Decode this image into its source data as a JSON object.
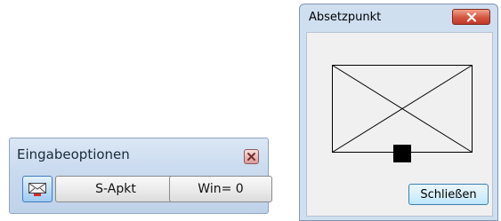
{
  "toolbar": {
    "title": "Eingabeoptionen",
    "buttons": {
      "sapkt": "S-Apkt",
      "win": "Win= 0"
    }
  },
  "dialog": {
    "title": "Absetzpunkt",
    "close_button": "Schließen"
  },
  "icons": {
    "toolbar_close": "close-icon",
    "toolbar_mode": "envelope-icon",
    "dialog_close": "close-icon",
    "symbol": "placement-point-icon"
  }
}
